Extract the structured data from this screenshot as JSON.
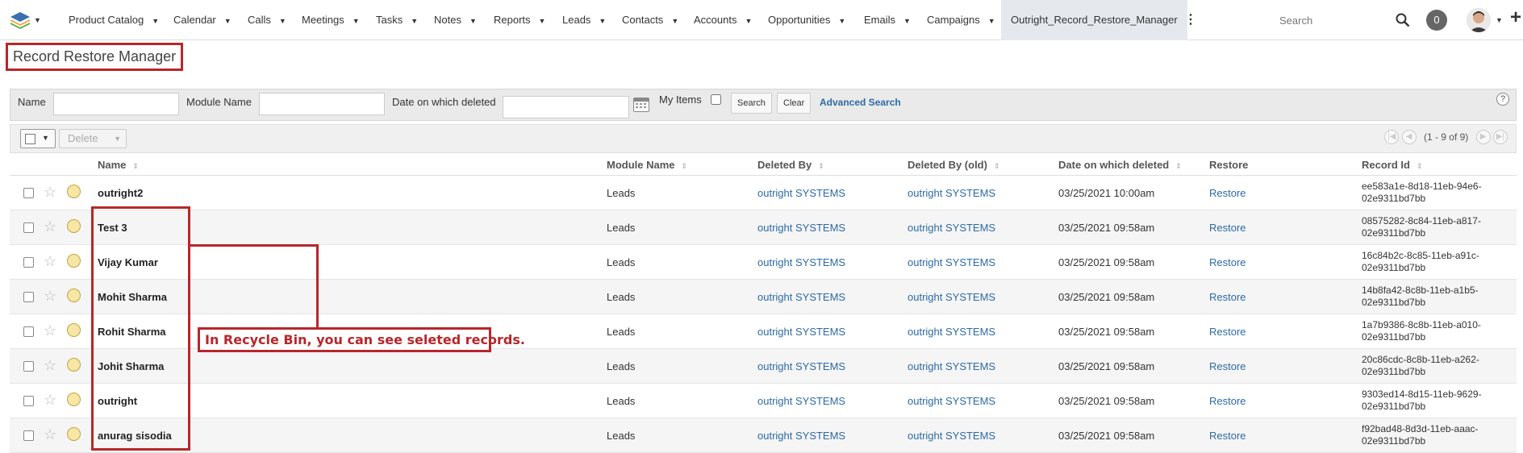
{
  "nav": {
    "items": [
      {
        "label": "Product Catalog"
      },
      {
        "label": "Calendar"
      },
      {
        "label": "Calls"
      },
      {
        "label": "Meetings"
      },
      {
        "label": "Tasks"
      },
      {
        "label": "Notes"
      },
      {
        "label": "Reports"
      },
      {
        "label": "Leads"
      },
      {
        "label": "Contacts"
      },
      {
        "label": "Accounts"
      },
      {
        "label": "Opportunities"
      },
      {
        "label": "Emails"
      },
      {
        "label": "Campaigns"
      }
    ],
    "active": "Outright_Record_Restore_Manager",
    "search_placeholder": "Search",
    "notification_count": "0"
  },
  "page": {
    "title": "Record Restore Manager"
  },
  "search": {
    "name_label": "Name",
    "module_label": "Module Name",
    "date_label": "Date on which deleted",
    "myitems_label": "My Items",
    "search_button": "Search",
    "clear_button": "Clear",
    "advanced_link": "Advanced Search",
    "help": "?"
  },
  "actions": {
    "delete_label": "Delete",
    "pagination": "(1 - 9 of 9)"
  },
  "table": {
    "headers": {
      "name": "Name",
      "module": "Module Name",
      "deleted_by": "Deleted By",
      "deleted_by_old": "Deleted By (old)",
      "date": "Date on which deleted",
      "restore": "Restore",
      "record_id": "Record Id"
    },
    "rows": [
      {
        "name": "outright2",
        "module": "Leads",
        "deleted_by": "outright SYSTEMS",
        "deleted_by_old": "outright SYSTEMS",
        "date": "03/25/2021 10:00am",
        "restore": "Restore",
        "id1": "ee583a1e-8d18-11eb-94e6-",
        "id2": "02e9311bd7bb"
      },
      {
        "name": "Test 3",
        "module": "Leads",
        "deleted_by": "outright SYSTEMS",
        "deleted_by_old": "outright SYSTEMS",
        "date": "03/25/2021 09:58am",
        "restore": "Restore",
        "id1": "08575282-8c84-11eb-a817-",
        "id2": "02e9311bd7bb"
      },
      {
        "name": "Vijay Kumar",
        "module": "Leads",
        "deleted_by": "outright SYSTEMS",
        "deleted_by_old": "outright SYSTEMS",
        "date": "03/25/2021 09:58am",
        "restore": "Restore",
        "id1": "16c84b2c-8c85-11eb-a91c-",
        "id2": "02e9311bd7bb"
      },
      {
        "name": "Mohit Sharma",
        "module": "Leads",
        "deleted_by": "outright SYSTEMS",
        "deleted_by_old": "outright SYSTEMS",
        "date": "03/25/2021 09:58am",
        "restore": "Restore",
        "id1": "14b8fa42-8c8b-11eb-a1b5-",
        "id2": "02e9311bd7bb"
      },
      {
        "name": "Rohit Sharma",
        "module": "Leads",
        "deleted_by": "outright SYSTEMS",
        "deleted_by_old": "outright SYSTEMS",
        "date": "03/25/2021 09:58am",
        "restore": "Restore",
        "id1": "1a7b9386-8c8b-11eb-a010-",
        "id2": "02e9311bd7bb"
      },
      {
        "name": "Johit Sharma",
        "module": "Leads",
        "deleted_by": "outright SYSTEMS",
        "deleted_by_old": "outright SYSTEMS",
        "date": "03/25/2021 09:58am",
        "restore": "Restore",
        "id1": "20c86cdc-8c8b-11eb-a262-",
        "id2": "02e9311bd7bb"
      },
      {
        "name": "outright",
        "module": "Leads",
        "deleted_by": "outright SYSTEMS",
        "deleted_by_old": "outright SYSTEMS",
        "date": "03/25/2021 09:58am",
        "restore": "Restore",
        "id1": "9303ed14-8d15-11eb-9629-",
        "id2": "02e9311bd7bb"
      },
      {
        "name": "anurag sisodia",
        "module": "Leads",
        "deleted_by": "outright SYSTEMS",
        "deleted_by_old": "outright SYSTEMS",
        "date": "03/25/2021 09:58am",
        "restore": "Restore",
        "id1": "f92bad48-8d3d-11eb-aaac-",
        "id2": "02e9311bd7bb"
      }
    ]
  },
  "annotation": {
    "text": "In Recycle Bin, you can see seleted records."
  }
}
